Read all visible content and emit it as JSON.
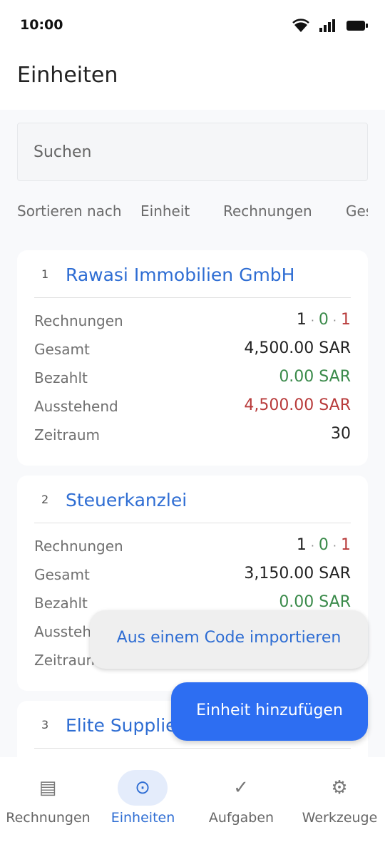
{
  "status_bar": {
    "time": "10:00"
  },
  "header": {
    "title": "Einheiten"
  },
  "search": {
    "placeholder": "Suchen"
  },
  "sort": {
    "label": "Sortieren nach",
    "options": [
      "Einheit",
      "Rechnungen",
      "Ges"
    ]
  },
  "units": [
    {
      "index": "1",
      "name": "Rawasi Immobilien GmbH",
      "rows": {
        "invoices_label": "Rechnungen",
        "invoices_counts": [
          "1",
          "0",
          "1"
        ],
        "total_label": "Gesamt",
        "total_value": "4,500.00 SAR",
        "paid_label": "Bezahlt",
        "paid_value": "0.00 SAR",
        "outstanding_label": "Ausstehend",
        "outstanding_value": "4,500.00 SAR",
        "period_label": "Zeitraum",
        "period_value": "30"
      }
    },
    {
      "index": "2",
      "name": "Steuerkanzlei",
      "rows": {
        "invoices_label": "Rechnungen",
        "invoices_counts": [
          "1",
          "0",
          "1"
        ],
        "total_label": "Gesamt",
        "total_value": "3,150.00 SAR",
        "paid_label": "Bezahlt",
        "paid_value": "0.00 SAR",
        "outstanding_label": "Ausstehend",
        "period_label": "Zeitraum"
      }
    },
    {
      "index": "3",
      "name": "Elite Supplies"
    }
  ],
  "actions": {
    "import_label": "Aus einem Code importieren",
    "add_label": "Einheit hinzufügen"
  },
  "nav": [
    {
      "label": "Rechnungen",
      "icon": "list-icon",
      "glyph": "▤"
    },
    {
      "label": "Einheiten",
      "icon": "units-icon",
      "glyph": "⊙",
      "active": true
    },
    {
      "label": "Aufgaben",
      "icon": "check-icon",
      "glyph": "✓"
    },
    {
      "label": "Werkzeuge",
      "icon": "gear-icon",
      "glyph": "⚙"
    }
  ],
  "colors": {
    "accent": "#2e6dd3",
    "fab": "#2d6ef2",
    "green": "#3a8a4a",
    "red": "#b83b3b"
  }
}
